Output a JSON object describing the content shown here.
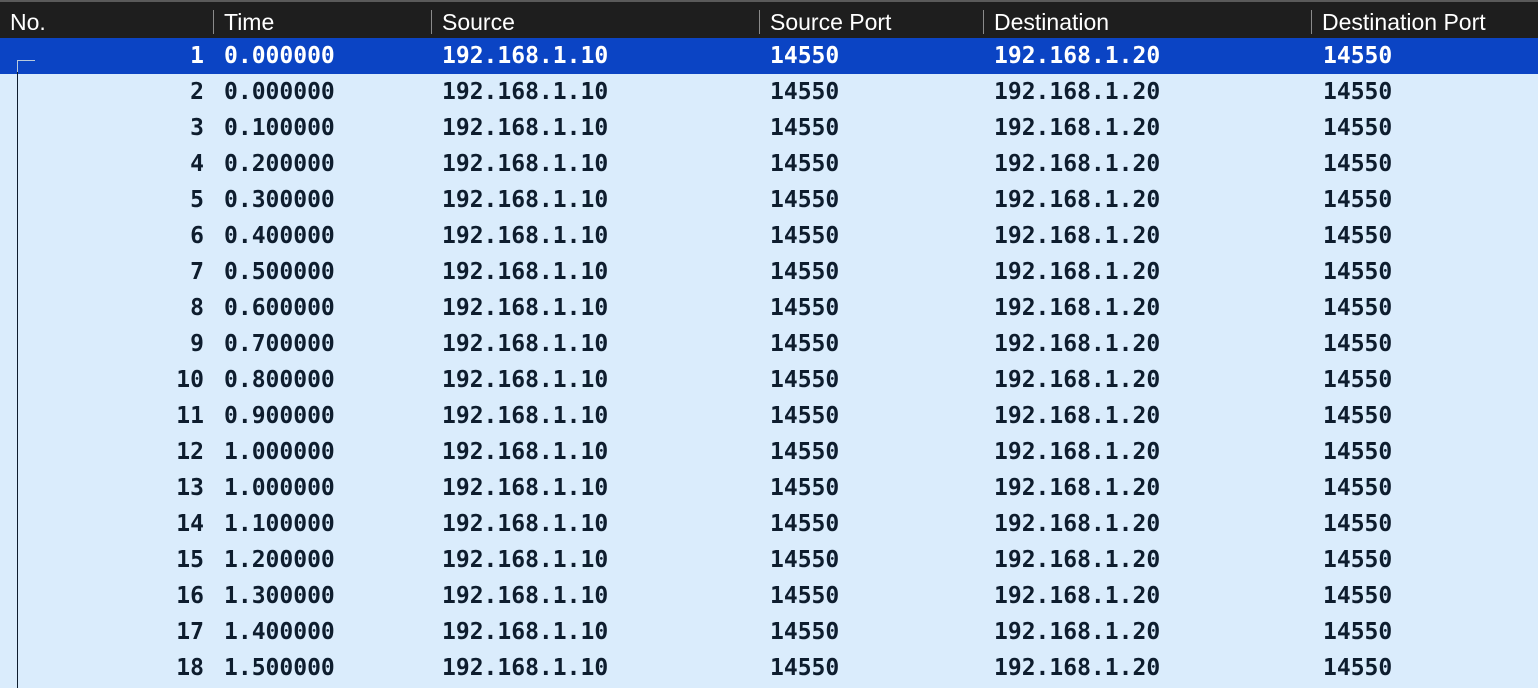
{
  "columns": {
    "no": "No.",
    "time": "Time",
    "source": "Source",
    "source_port": "Source Port",
    "destination": "Destination",
    "destination_port": "Destination Port"
  },
  "selected_row": 1,
  "colors": {
    "header_bg": "#1e1e1e",
    "row_bg": "#daecfc",
    "selected_bg": "#0b44c4",
    "text": "#0e1d2e"
  },
  "packets": [
    {
      "no": "1",
      "time": "0.000000",
      "source": "192.168.1.10",
      "source_port": "14550",
      "destination": "192.168.1.20",
      "destination_port": "14550"
    },
    {
      "no": "2",
      "time": "0.000000",
      "source": "192.168.1.10",
      "source_port": "14550",
      "destination": "192.168.1.20",
      "destination_port": "14550"
    },
    {
      "no": "3",
      "time": "0.100000",
      "source": "192.168.1.10",
      "source_port": "14550",
      "destination": "192.168.1.20",
      "destination_port": "14550"
    },
    {
      "no": "4",
      "time": "0.200000",
      "source": "192.168.1.10",
      "source_port": "14550",
      "destination": "192.168.1.20",
      "destination_port": "14550"
    },
    {
      "no": "5",
      "time": "0.300000",
      "source": "192.168.1.10",
      "source_port": "14550",
      "destination": "192.168.1.20",
      "destination_port": "14550"
    },
    {
      "no": "6",
      "time": "0.400000",
      "source": "192.168.1.10",
      "source_port": "14550",
      "destination": "192.168.1.20",
      "destination_port": "14550"
    },
    {
      "no": "7",
      "time": "0.500000",
      "source": "192.168.1.10",
      "source_port": "14550",
      "destination": "192.168.1.20",
      "destination_port": "14550"
    },
    {
      "no": "8",
      "time": "0.600000",
      "source": "192.168.1.10",
      "source_port": "14550",
      "destination": "192.168.1.20",
      "destination_port": "14550"
    },
    {
      "no": "9",
      "time": "0.700000",
      "source": "192.168.1.10",
      "source_port": "14550",
      "destination": "192.168.1.20",
      "destination_port": "14550"
    },
    {
      "no": "10",
      "time": "0.800000",
      "source": "192.168.1.10",
      "source_port": "14550",
      "destination": "192.168.1.20",
      "destination_port": "14550"
    },
    {
      "no": "11",
      "time": "0.900000",
      "source": "192.168.1.10",
      "source_port": "14550",
      "destination": "192.168.1.20",
      "destination_port": "14550"
    },
    {
      "no": "12",
      "time": "1.000000",
      "source": "192.168.1.10",
      "source_port": "14550",
      "destination": "192.168.1.20",
      "destination_port": "14550"
    },
    {
      "no": "13",
      "time": "1.000000",
      "source": "192.168.1.10",
      "source_port": "14550",
      "destination": "192.168.1.20",
      "destination_port": "14550"
    },
    {
      "no": "14",
      "time": "1.100000",
      "source": "192.168.1.10",
      "source_port": "14550",
      "destination": "192.168.1.20",
      "destination_port": "14550"
    },
    {
      "no": "15",
      "time": "1.200000",
      "source": "192.168.1.10",
      "source_port": "14550",
      "destination": "192.168.1.20",
      "destination_port": "14550"
    },
    {
      "no": "16",
      "time": "1.300000",
      "source": "192.168.1.10",
      "source_port": "14550",
      "destination": "192.168.1.20",
      "destination_port": "14550"
    },
    {
      "no": "17",
      "time": "1.400000",
      "source": "192.168.1.10",
      "source_port": "14550",
      "destination": "192.168.1.20",
      "destination_port": "14550"
    },
    {
      "no": "18",
      "time": "1.500000",
      "source": "192.168.1.10",
      "source_port": "14550",
      "destination": "192.168.1.20",
      "destination_port": "14550"
    }
  ]
}
